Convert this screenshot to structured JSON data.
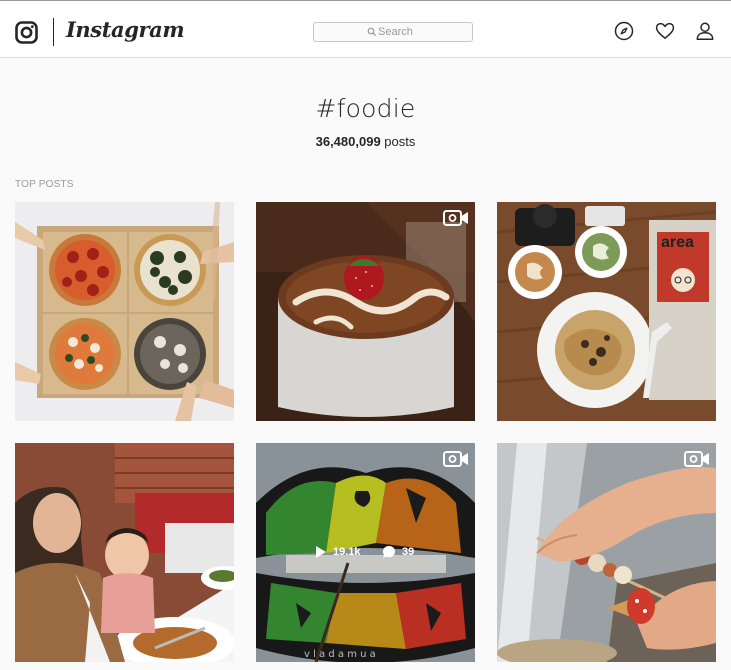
{
  "header": {
    "wordmark": "Instagram",
    "search_placeholder": "Search"
  },
  "nav_icons": [
    "explore-compass-icon",
    "activity-heart-icon",
    "profile-person-icon"
  ],
  "hashtag": {
    "title": "#foodie",
    "post_count_number": "36,480,099",
    "post_count_suffix": " posts"
  },
  "section": {
    "label": "TOP POSTS"
  },
  "posts": [
    {
      "subject": "pizzas",
      "type": "photo"
    },
    {
      "subject": "tiramisu cake",
      "type": "video"
    },
    {
      "subject": "coffee and pasta",
      "type": "photo"
    },
    {
      "subject": "mother and baby",
      "type": "photo"
    },
    {
      "subject": "painted lips",
      "type": "video",
      "hover_plays": "19.1k",
      "hover_comments": "39",
      "watermark": "v l a d a m u a"
    },
    {
      "subject": "hand with skewer",
      "type": "video"
    }
  ],
  "colors": {
    "background": "#fafafa",
    "text": "#262626",
    "muted": "#999999",
    "border": "#dbdbdb"
  }
}
